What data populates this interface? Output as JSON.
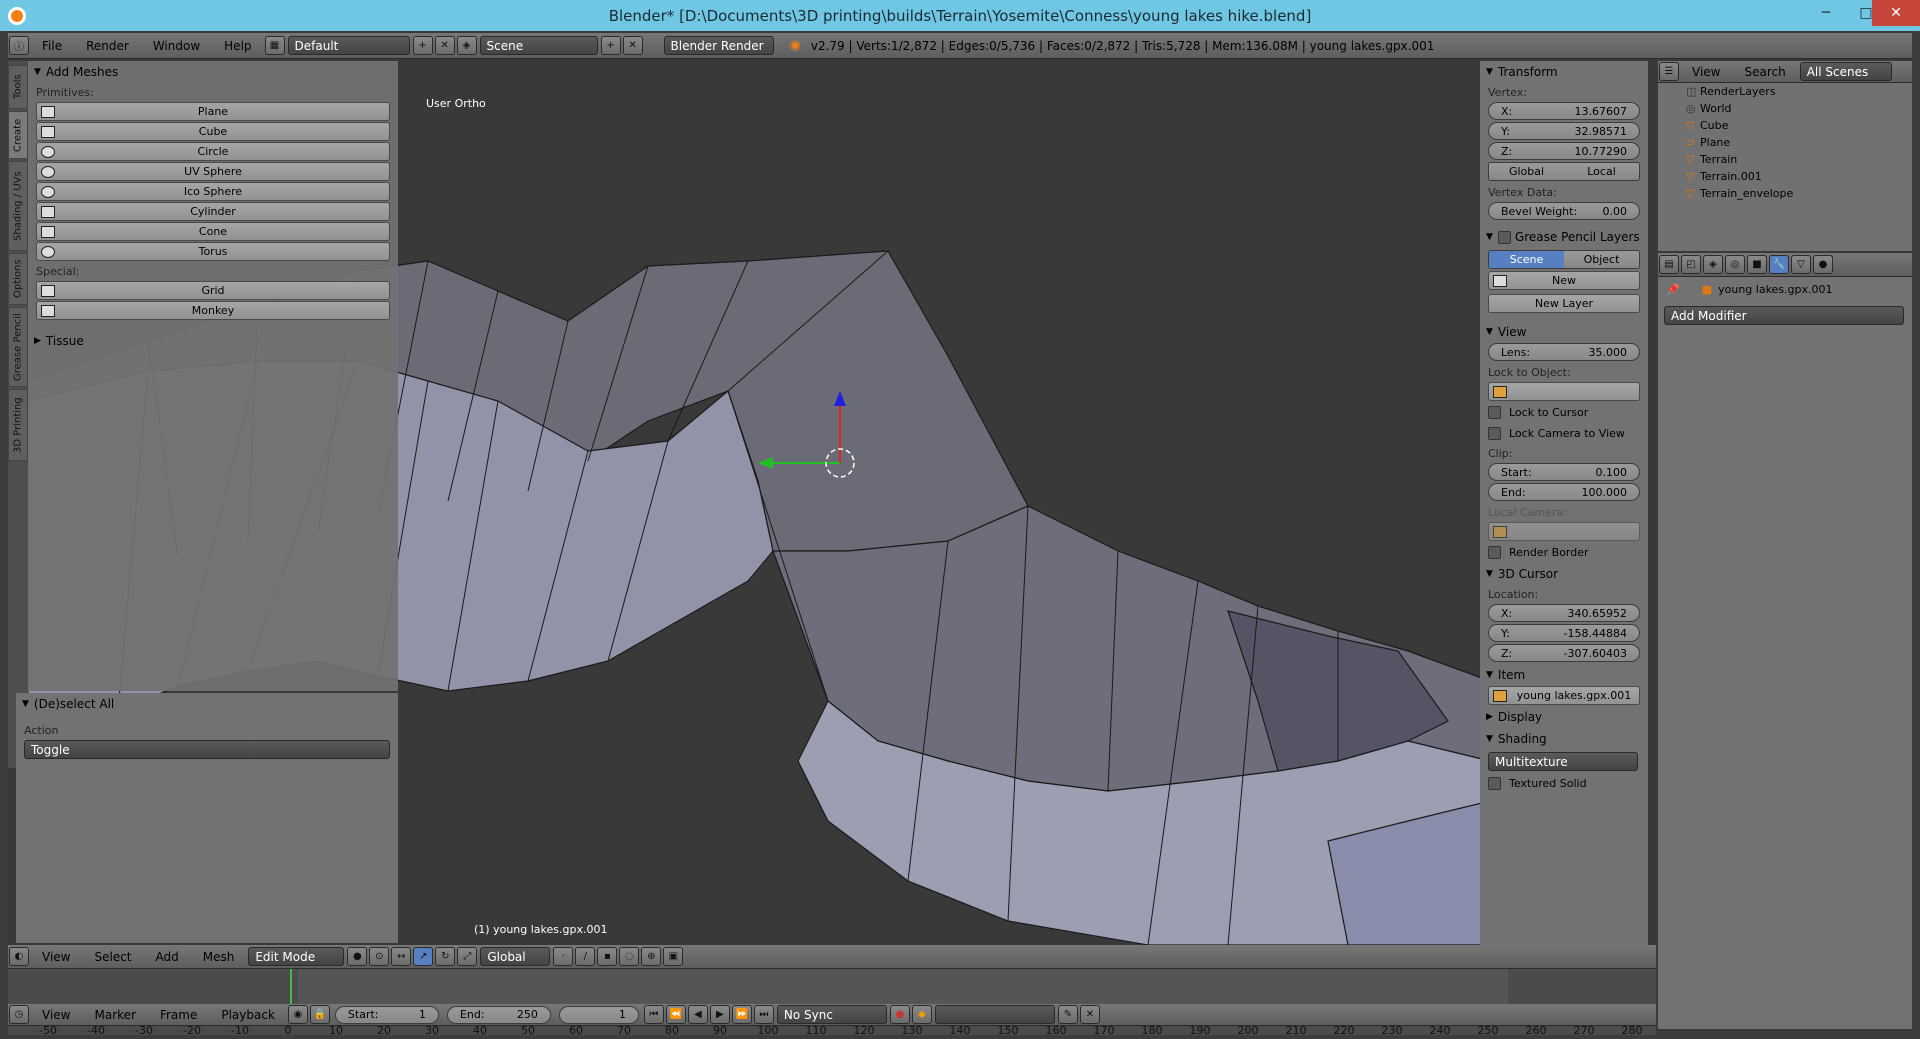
{
  "window": {
    "title": "Blender* [D:\\Documents\\3D printing\\builds\\Terrain\\Yosemite\\Conness\\young lakes hike.blend]",
    "minimize": "─",
    "maximize": "□",
    "close": "✕"
  },
  "info_header": {
    "menus": [
      "File",
      "Render",
      "Window",
      "Help"
    ],
    "layout": "Default",
    "scene": "Scene",
    "engine": "Blender Render",
    "stats": "v2.79 | Verts:1/2,872 | Edges:0/5,736 | Faces:0/2,872 | Tris:5,728 | Mem:136.08M | young lakes.gpx.001"
  },
  "tool_tabs": [
    "Tools",
    "Create",
    "Shading / UVs",
    "Options",
    "Grease Pencil",
    "3D Printing"
  ],
  "add_meshes": {
    "title": "Add Meshes",
    "primitives_label": "Primitives:",
    "primitives": [
      {
        "label": "Plane",
        "icon": "plane-icon"
      },
      {
        "label": "Cube",
        "icon": "cube-icon"
      },
      {
        "label": "Circle",
        "icon": "circle-icon"
      },
      {
        "label": "UV Sphere",
        "icon": "uv-sphere-icon"
      },
      {
        "label": "Ico Sphere",
        "icon": "ico-sphere-icon"
      },
      {
        "label": "Cylinder",
        "icon": "cylinder-icon"
      },
      {
        "label": "Cone",
        "icon": "cone-icon"
      },
      {
        "label": "Torus",
        "icon": "torus-icon"
      }
    ],
    "special_label": "Special:",
    "special": [
      {
        "label": "Grid",
        "icon": "grid-icon"
      },
      {
        "label": "Monkey",
        "icon": "monkey-icon"
      }
    ]
  },
  "tissue": {
    "title": "Tissue"
  },
  "operator": {
    "title": "(De)select All",
    "action_label": "Action",
    "action_value": "Toggle"
  },
  "viewport": {
    "view_name": "User Ortho",
    "object_name": "(1) young lakes.gpx.001"
  },
  "properties": {
    "transform_title": "Transform",
    "vertex_label": "Vertex:",
    "vx": {
      "label": "X:",
      "value": "13.67607"
    },
    "vy": {
      "label": "Y:",
      "value": "32.98571"
    },
    "vz": {
      "label": "Z:",
      "value": "10.77290"
    },
    "global": "Global",
    "local": "Local",
    "vertex_data_label": "Vertex Data:",
    "bevel": {
      "label": "Bevel Weight:",
      "value": "0.00"
    },
    "gp_title": "Grease Pencil Layers",
    "gp_scene": "Scene",
    "gp_object": "Object",
    "gp_new": "New",
    "gp_new_layer": "New Layer",
    "view_title": "View",
    "lens": {
      "label": "Lens:",
      "value": "35.000"
    },
    "lock_to_object": "Lock to Object:",
    "lock_to_cursor": "Lock to Cursor",
    "lock_camera": "Lock Camera to View",
    "clip_label": "Clip:",
    "clip_start": {
      "label": "Start:",
      "value": "0.100"
    },
    "clip_end": {
      "label": "End:",
      "value": "100.000"
    },
    "local_camera": "Local Camera:",
    "render_border": "Render Border",
    "cursor_title": "3D Cursor",
    "location_label": "Location:",
    "cx": {
      "label": "X:",
      "value": "340.65952"
    },
    "cy": {
      "label": "Y:",
      "value": "-158.44884"
    },
    "cz": {
      "label": "Z:",
      "value": "-307.60403"
    },
    "item_title": "Item",
    "item_name": "young lakes.gpx.001",
    "display_title": "Display",
    "shading_title": "Shading",
    "shading_mode": "Multitexture",
    "textured_solid": "Textured Solid"
  },
  "outliner": {
    "view": "View",
    "search": "Search",
    "scenes": "All Scenes",
    "items": [
      {
        "label": "RenderLayers",
        "icon": "render-layers-icon"
      },
      {
        "label": "World",
        "icon": "world-icon"
      },
      {
        "label": "Cube",
        "icon": "mesh-icon"
      },
      {
        "label": "Plane",
        "icon": "curve-icon"
      },
      {
        "label": "Terrain",
        "icon": "mesh-icon"
      },
      {
        "label": "Terrain.001",
        "icon": "mesh-icon"
      },
      {
        "label": "Terrain_envelope",
        "icon": "mesh-icon"
      }
    ]
  },
  "modifiers": {
    "object_name": "young lakes.gpx.001",
    "add_modifier": "Add Modifier"
  },
  "view3d_header": {
    "menus": [
      "View",
      "Select",
      "Add",
      "Mesh"
    ],
    "mode": "Edit Mode",
    "orientation": "Global"
  },
  "timeline": {
    "ticks": [
      "-50",
      "-40",
      "-30",
      "-20",
      "-10",
      "0",
      "10",
      "20",
      "30",
      "40",
      "50",
      "60",
      "70",
      "80",
      "90",
      "100",
      "110",
      "120",
      "130",
      "140",
      "150",
      "160",
      "170",
      "180",
      "190",
      "200",
      "210",
      "220",
      "230",
      "240",
      "250",
      "260",
      "270",
      "280"
    ],
    "menus": [
      "View",
      "Marker",
      "Frame",
      "Playback"
    ],
    "start": {
      "label": "Start:",
      "value": "1"
    },
    "end": {
      "label": "End:",
      "value": "250"
    },
    "current": "1",
    "sync": "No Sync"
  },
  "colors": {
    "accent_blue": "#5680c2",
    "title_bar": "#6fc7e3",
    "mesh_face": "#8d8fa8"
  }
}
